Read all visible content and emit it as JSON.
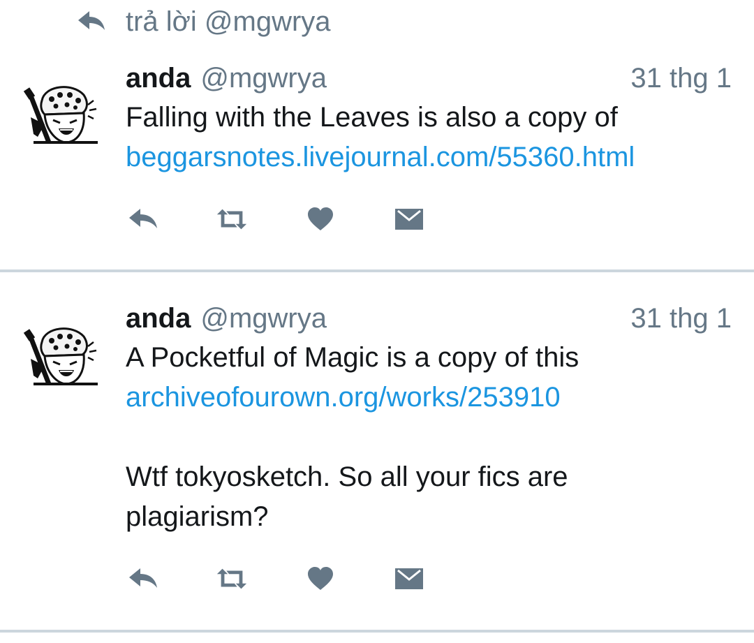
{
  "reply_header": {
    "text": "trả lời @mgwrya"
  },
  "tweets": [
    {
      "name": "anda",
      "handle": "@mgwrya",
      "time": "31 thg 1",
      "lines": [
        {
          "text": "Falling with the Leaves is also a copy of",
          "type": "text"
        },
        {
          "text": "beggarsnotes.livejournal.com/55360.html",
          "type": "link"
        }
      ]
    },
    {
      "name": "anda",
      "handle": "@mgwrya",
      "time": "31 thg 1",
      "lines": [
        {
          "text": "A Pocketful of Magic is a copy of this",
          "type": "text"
        },
        {
          "text": "archiveofourown.org/works/253910",
          "type": "link"
        },
        {
          "text": "Wtf tokyosketch. So all your fics are",
          "type": "text"
        },
        {
          "text": "plagiarism?",
          "type": "text"
        }
      ]
    }
  ],
  "colors": {
    "text": "#14171a",
    "muted": "#657786",
    "link": "#1b95e0",
    "divider": "#ccd6dd"
  },
  "icons": [
    "reply-icon",
    "retweet-icon",
    "like-icon",
    "direct-message-icon"
  ]
}
